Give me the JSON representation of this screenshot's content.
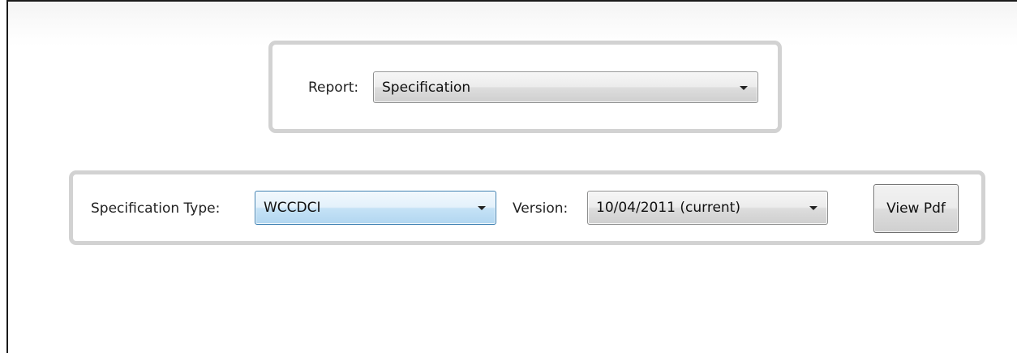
{
  "report": {
    "label": "Report:",
    "selected": "Specification",
    "arrow_icon": "chevron-down-icon"
  },
  "specification_type": {
    "label": "Specification Type:",
    "selected": "WCCDCI",
    "arrow_icon": "chevron-down-icon"
  },
  "version": {
    "label": "Version:",
    "selected": "10/04/2011 (current)",
    "arrow_icon": "chevron-down-icon"
  },
  "view_pdf": {
    "label": "View Pdf"
  },
  "colors": {
    "panel_border": "#d2d2d2",
    "focus_border": "#3c7fb1",
    "window_border": "#1a1a1a"
  }
}
